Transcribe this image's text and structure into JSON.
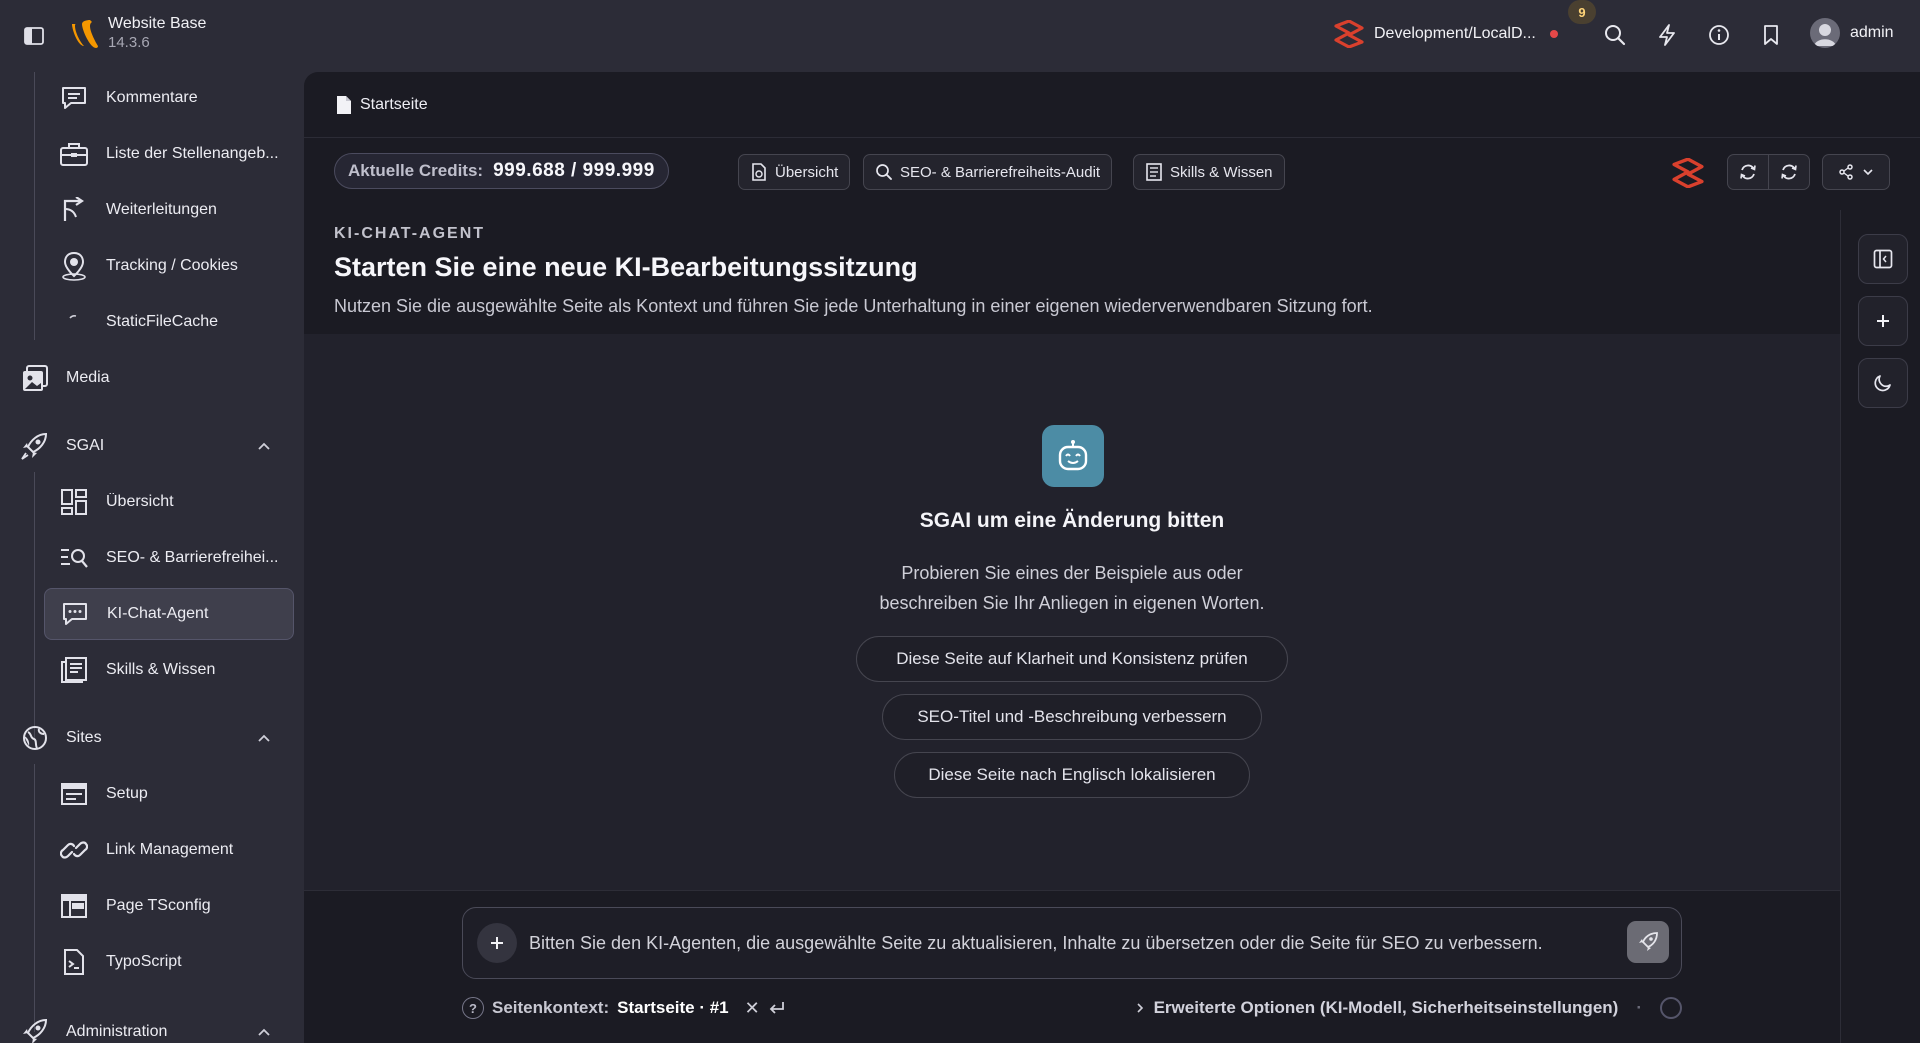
{
  "topbar": {
    "site_name": "Website Base",
    "site_version": "14.3.6",
    "environment": "Development/LocalD...",
    "notification_count": "9",
    "user_name": "admin"
  },
  "sidebar": {
    "items_top": [
      {
        "label": "Kommentare",
        "icon": "comment-icon"
      },
      {
        "label": "Liste der Stellenangeb...",
        "icon": "briefcase-icon"
      },
      {
        "label": "Weiterleitungen",
        "icon": "redirect-icon"
      },
      {
        "label": "Tracking / Cookies",
        "icon": "location-pin-icon"
      },
      {
        "label": "StaticFileCache",
        "icon": "loading-icon"
      }
    ],
    "media": "Media",
    "sgai": {
      "label": "SGAI",
      "items": [
        {
          "label": "Übersicht",
          "icon": "dashboard-icon"
        },
        {
          "label": "SEO- & Barrierefreihei...",
          "icon": "search-list-icon"
        },
        {
          "label": "KI-Chat-Agent",
          "icon": "chat-icon",
          "active": true
        },
        {
          "label": "Skills & Wissen",
          "icon": "book-icon"
        }
      ]
    },
    "sites": {
      "label": "Sites",
      "items": [
        {
          "label": "Setup",
          "icon": "window-icon"
        },
        {
          "label": "Link Management",
          "icon": "link-icon"
        },
        {
          "label": "Page TSconfig",
          "icon": "layout-icon"
        },
        {
          "label": "TypoScript",
          "icon": "script-file-icon"
        }
      ]
    },
    "administration": "Administration"
  },
  "breadcrumb": {
    "page": "Startseite"
  },
  "toolbar": {
    "credits_label": "Aktuelle Credits:",
    "credits_value": "999.688 / 999.999",
    "overview": "Übersicht",
    "seo_audit": "SEO- & Barrierefreiheits-Audit",
    "skills": "Skills & Wissen"
  },
  "header": {
    "eyebrow": "KI-CHAT-AGENT",
    "title": "Starten Sie eine neue KI-Bearbeitungssitzung",
    "subtitle": "Nutzen Sie die ausgewählte Seite als Kontext und führen Sie jede Unterhaltung in einer eigenen wiederverwendbaren Sitzung fort."
  },
  "empty_state": {
    "title": "SGAI um eine Änderung bitten",
    "text": "Probieren Sie eines der Beispiele aus oder beschreiben Sie Ihr Anliegen in eigenen Worten.",
    "suggestions": [
      "Diese Seite auf Klarheit und Konsistenz prüfen",
      "SEO-Titel und -Beschreibung verbessern",
      "Diese Seite nach Englisch lokalisieren"
    ]
  },
  "composer": {
    "placeholder": "Bitten Sie den KI-Agenten, die ausgewählte Seite zu aktualisieren, Inhalte zu übersetzen oder die Seite für SEO zu verbessern."
  },
  "context": {
    "label": "Seitenkontext:",
    "value": "Startseite · #1",
    "advanced": "Erweiterte Optionen (KI-Modell, Sicherheitseinstellungen)"
  },
  "colors": {
    "accent_robot": "#4c8ca5",
    "brand_red": "#d9402d",
    "notification": "#e54848"
  }
}
